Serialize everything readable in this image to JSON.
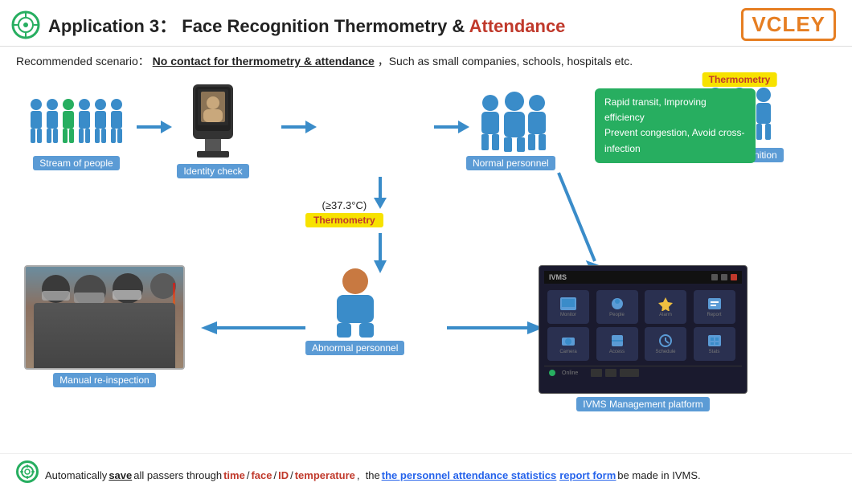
{
  "header": {
    "title_prefix": "Application 3：",
    "title_middle": "Face Recognition Thermometry & ",
    "title_attendance": "Attendance",
    "logo": "VCLEY"
  },
  "scenario": {
    "label": "Recommended scenario：",
    "underlined": "No contact for thermometry & attendance",
    "rest": "，Such as small companies, schools, hospitals etc."
  },
  "flow": {
    "stream_label": "Stream of people",
    "identity_label": "Identity check",
    "facerecog_label": "Face Recognition",
    "thermometry_badge": "Thermometry",
    "normal_label": "Normal personnel",
    "green_line1": "Rapid transit, Improving efficiency",
    "green_line2": "Prevent congestion, Avoid cross-infection",
    "temp_label": "(≥37.3°C)",
    "thermo_label2": "Thermometry",
    "abnormal_label": "Abnormal personnel",
    "photo_label": "Manual re-inspection",
    "ivms_title": "IVMS",
    "ivms_platform_label": "IVMS Management platform"
  },
  "bottom": {
    "prefix": "Automatically ",
    "save_bold": "save",
    "mid1": " all passers through ",
    "time": "time",
    "slash1": " / ",
    "face": "face",
    "slash2": " / ",
    "id": "ID",
    "slash3": " / ",
    "temperature": "temperature",
    "comma": ",  the ",
    "stats_bold": "the personnel attendance statistics",
    "report_bold": "report form",
    "end": " be made in IVMS."
  },
  "colors": {
    "blue": "#3a8cc9",
    "green": "#27ae60",
    "red": "#c0392b",
    "yellow": "#f7e200",
    "dark_bg": "#1a1a2e",
    "label_bg": "#5b9bd5",
    "orange": "#e67e22"
  }
}
